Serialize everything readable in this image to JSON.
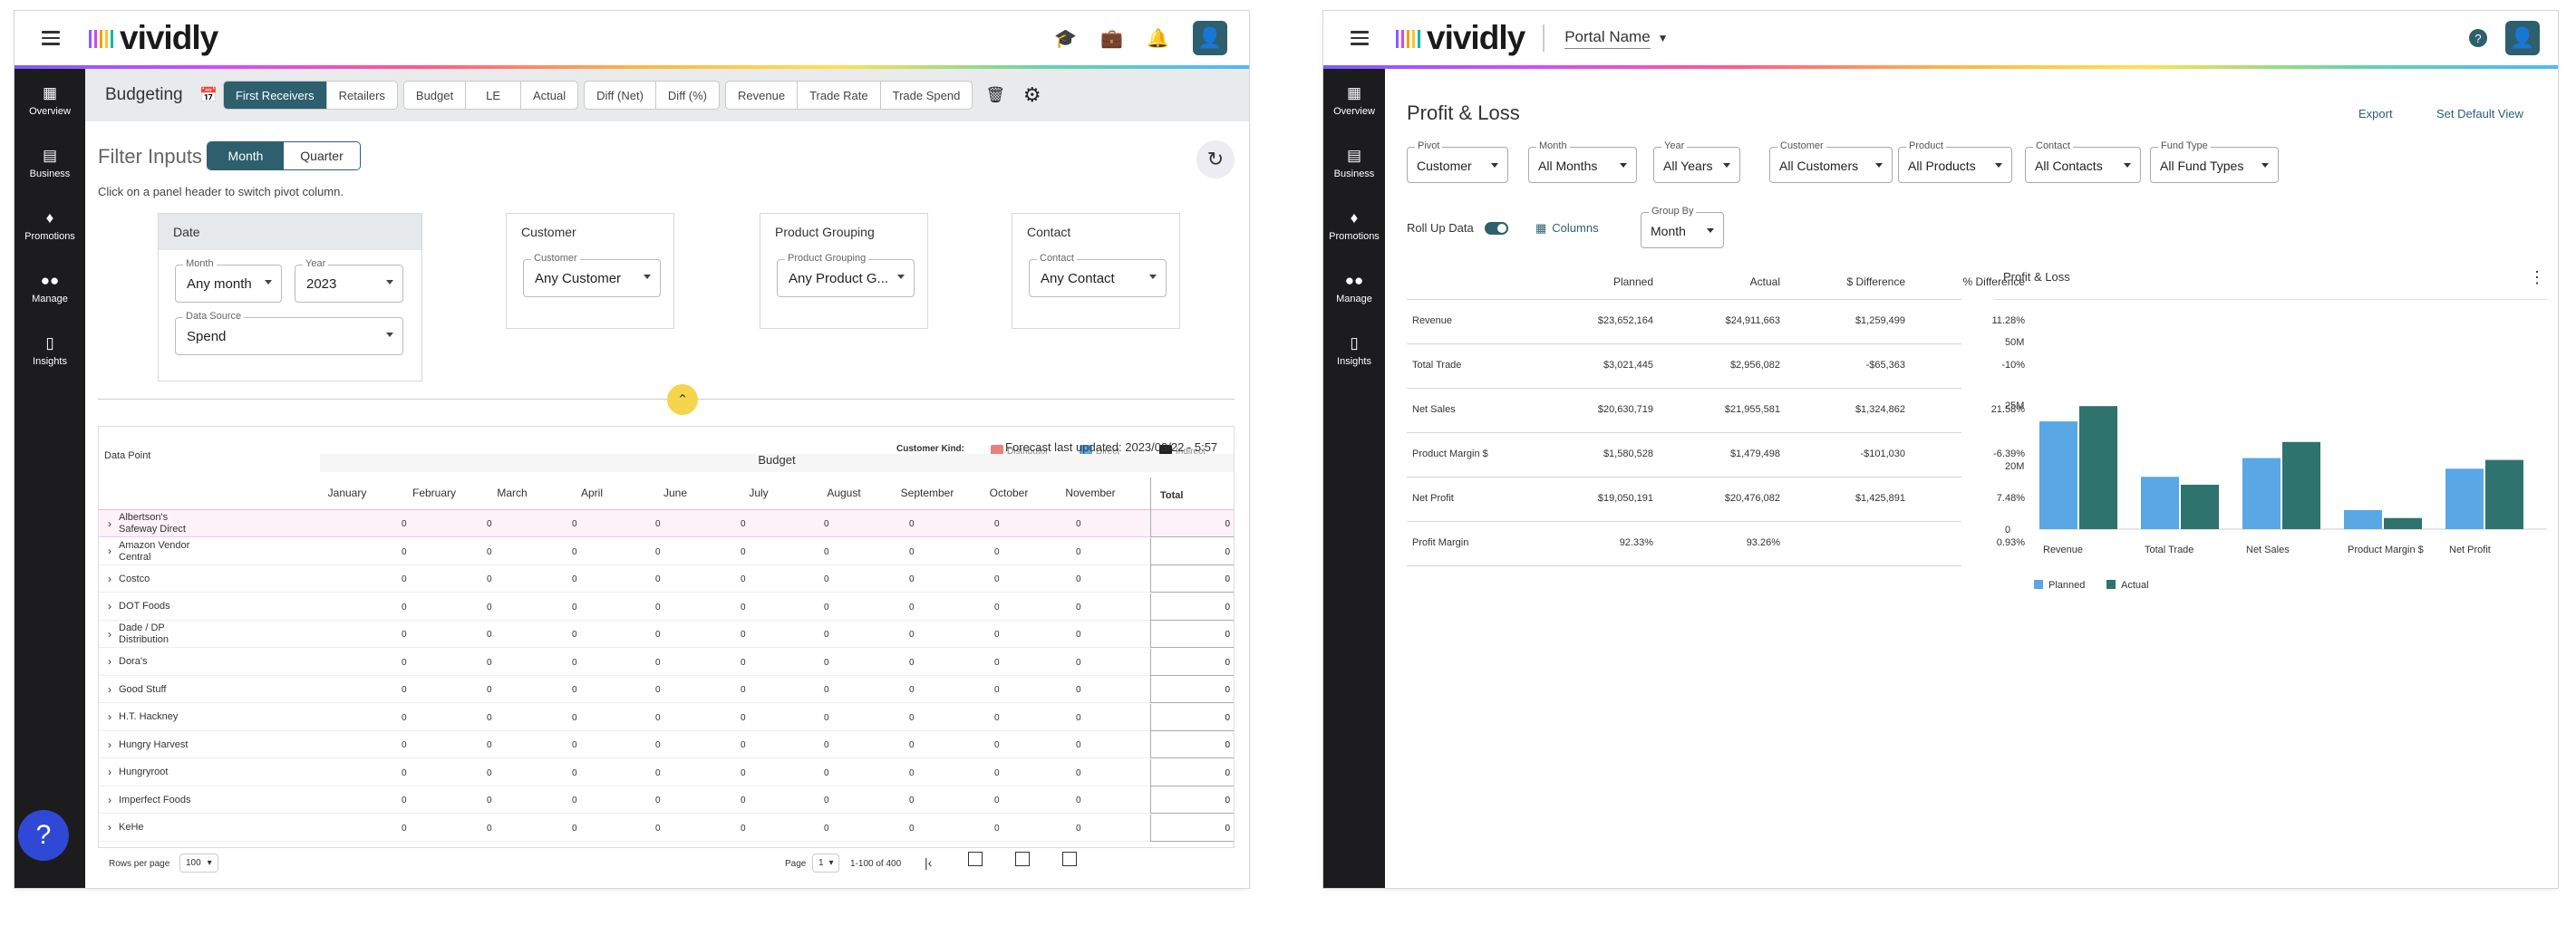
{
  "window1": {
    "app_name": "vividly",
    "sidebar": [
      {
        "label": "Overview",
        "icon": "overview-icon"
      },
      {
        "label": "Business",
        "icon": "business-icon"
      },
      {
        "label": "Promotions",
        "icon": "promotions-icon"
      },
      {
        "label": "Manage",
        "icon": "manage-icon"
      },
      {
        "label": "Insights",
        "icon": "insights-icon"
      }
    ],
    "toolbar": {
      "title": "Budgeting",
      "group1": [
        "First Receivers",
        "Retailers"
      ],
      "group2": [
        "Budget",
        "LE",
        "Actual"
      ],
      "group3": [
        "Diff (Net)",
        "Diff (%)"
      ],
      "group4": [
        "Revenue",
        "Trade Rate",
        "Trade Spend"
      ]
    },
    "filter": {
      "title": "Filter Inputs",
      "toggle": [
        "Month",
        "Quarter"
      ],
      "hint": "Click on a panel header to switch pivot column."
    },
    "panels": {
      "date": {
        "title": "Date",
        "month_label": "Month",
        "month_value": "Any month",
        "year_label": "Year",
        "year_value": "2023",
        "source_label": "Data Source",
        "source_value": "Spend"
      },
      "customer": {
        "title": "Customer",
        "label": "Customer",
        "value": "Any Customer"
      },
      "product": {
        "title": "Product Grouping",
        "label": "Product Grouping",
        "value": "Any Product G..."
      },
      "contact": {
        "title": "Contact",
        "label": "Contact",
        "value": "Any Contact"
      }
    },
    "grid": {
      "data_point": "Data Point",
      "customer_kind": "Customer Kind:",
      "forecast": "Forecast last updated: 2023/03/22 - 5:57 am",
      "legend": [
        "Distributor",
        "Direct",
        "Indirect"
      ],
      "group_header": "Budget",
      "months": [
        "January",
        "February",
        "March",
        "April",
        "June",
        "July",
        "August",
        "September",
        "October",
        "November"
      ],
      "total_label": "Total",
      "rows": [
        "Albertson's Safeway Direct",
        "Amazon Vendor Central",
        "Costco",
        "DOT Foods",
        "Dade / DP Distribution",
        "Dora's",
        "Good Stuff",
        "H.T. Hackney",
        "Hungry Harvest",
        "Hungryroot",
        "Imperfect Foods",
        "KeHe"
      ],
      "cell_value": "0"
    },
    "pager": {
      "rows_per_page_label": "Rows per page",
      "rows_per_page": "100",
      "page_label": "Page",
      "page": "1",
      "range": "1-100 of 400"
    },
    "help": "?"
  },
  "window2": {
    "app_name": "vividly",
    "portal": "Portal Name",
    "sidebar": [
      {
        "label": "Overview",
        "icon": "overview-icon"
      },
      {
        "label": "Business",
        "icon": "business-icon"
      },
      {
        "label": "Promotions",
        "icon": "promotions-icon"
      },
      {
        "label": "Manage",
        "icon": "manage-icon"
      },
      {
        "label": "Insights",
        "icon": "insights-icon"
      }
    ],
    "title": "Profit & Loss",
    "export": "Export",
    "set_default": "Set Default View",
    "filters": [
      {
        "label": "Pivot",
        "value": "Customer"
      },
      {
        "label": "Month",
        "value": "All Months"
      },
      {
        "label": "Year",
        "value": "All Years"
      },
      {
        "label": "Customer",
        "value": "All Customers"
      },
      {
        "label": "Product",
        "value": "All Products"
      },
      {
        "label": "Contact",
        "value": "All Contacts"
      },
      {
        "label": "Fund Type",
        "value": "All Fund Types"
      }
    ],
    "rollup": "Roll Up Data",
    "columns": "Columns",
    "group_by": {
      "label": "Group By",
      "value": "Month"
    },
    "table": {
      "headers": [
        "Planned",
        "Actual",
        "$ Difference",
        "% Difference"
      ],
      "rows": [
        {
          "name": "Revenue",
          "planned": "$23,652,164",
          "actual": "$24,911,663",
          "diff": "$1,259,499",
          "pct": "11.28%"
        },
        {
          "name": "Total Trade",
          "planned": "$3,021,445",
          "actual": "$2,956,082",
          "diff": "-$65,363",
          "pct": "-10%"
        },
        {
          "name": "Net Sales",
          "planned": "$20,630,719",
          "actual": "$21,955,581",
          "diff": "$1,324,862",
          "pct": "21.58%"
        },
        {
          "name": "Product Margin $",
          "planned": "$1,580,528",
          "actual": "$1,479,498",
          "diff": "-$101,030",
          "pct": "-6.39%"
        },
        {
          "name": "Net Profit",
          "planned": "$19,050,191",
          "actual": "$20,476,082",
          "diff": "$1,425,891",
          "pct": "7.48%"
        },
        {
          "name": "Profit Margin",
          "planned": "92.33%",
          "actual": "93.26%",
          "diff": "",
          "pct": "0.93%"
        }
      ]
    },
    "chart_title": "Profit & Loss"
  },
  "chart_data": {
    "type": "bar",
    "title": "Profit & Loss",
    "categories": [
      "Revenue",
      "Total Trade",
      "Net Sales",
      "Product Margin $",
      "Net Profit"
    ],
    "series": [
      {
        "name": "Planned",
        "color": "#5aa7e6",
        "values": [
          23652164,
          16500000,
          20630719,
          6000000,
          19050191
        ]
      },
      {
        "name": "Actual",
        "color": "#2e736d",
        "values": [
          24911663,
          14000000,
          21955581,
          3500000,
          20476082
        ]
      }
    ],
    "yticks": [
      "50M",
      "25M",
      "20M",
      "0"
    ],
    "ylim": [
      0,
      50000000
    ],
    "legend": "bottom-left"
  }
}
